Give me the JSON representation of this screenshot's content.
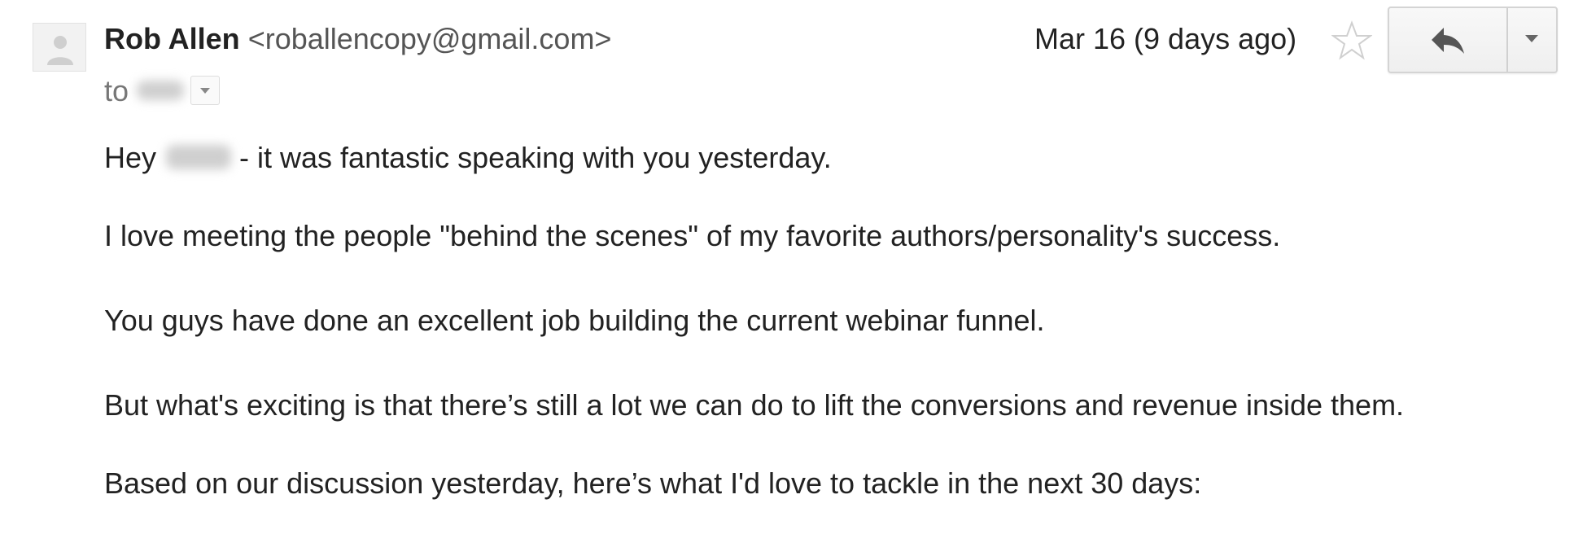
{
  "header": {
    "sender_name": "Rob Allen",
    "sender_email": "<roballencopy@gmail.com>",
    "date": "Mar 16 (9 days ago)",
    "to_label": "to",
    "avatar_icon": "person-silhouette-icon",
    "star_icon": "star-outline-icon",
    "reply_icon": "reply-arrow-icon",
    "more_icon": "chevron-down-icon"
  },
  "body": {
    "greeting_start": "Hey",
    "greeting_end": "- it was fantastic speaking with you yesterday.",
    "paragraphs": [
      "I love meeting the people \"behind the scenes\" of my favorite authors/personality's success.",
      "You guys have done an excellent job building the current webinar funnel.",
      "But what's exciting is that there’s still a lot we can do to lift the conversions and revenue inside them.",
      "Based on our discussion yesterday, here’s what I'd love to tackle in the next 30 days:"
    ]
  },
  "colors": {
    "text": "#222222",
    "email": "#555555",
    "muted": "#777777",
    "button_border": "#d4d4d4"
  }
}
